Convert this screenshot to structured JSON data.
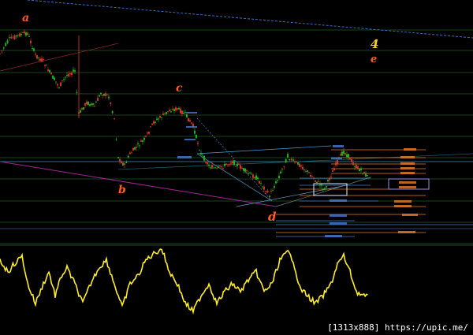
{
  "colors": {
    "background": "#000000",
    "grid_line": "#1f5a1f",
    "candle_up": "#1fc21f",
    "candle_down": "#e23a2a",
    "wave_label": "#ff5a1a",
    "wave_label_4": "#ffd21a",
    "trend_blue": "#3a6fbf",
    "trend_magenta": "#a0268f",
    "fib_orange": "#e67d2a",
    "fib_blue": "#4a7bd0",
    "oscillator": "#ffee22",
    "highlight_box": "#9a8df0"
  },
  "wave_labels": {
    "a": "a",
    "b": "b",
    "c1": "c",
    "d": "d",
    "four": "4",
    "e": "e"
  },
  "footer": {
    "text": "[1313x888] https://upic.me/"
  }
}
